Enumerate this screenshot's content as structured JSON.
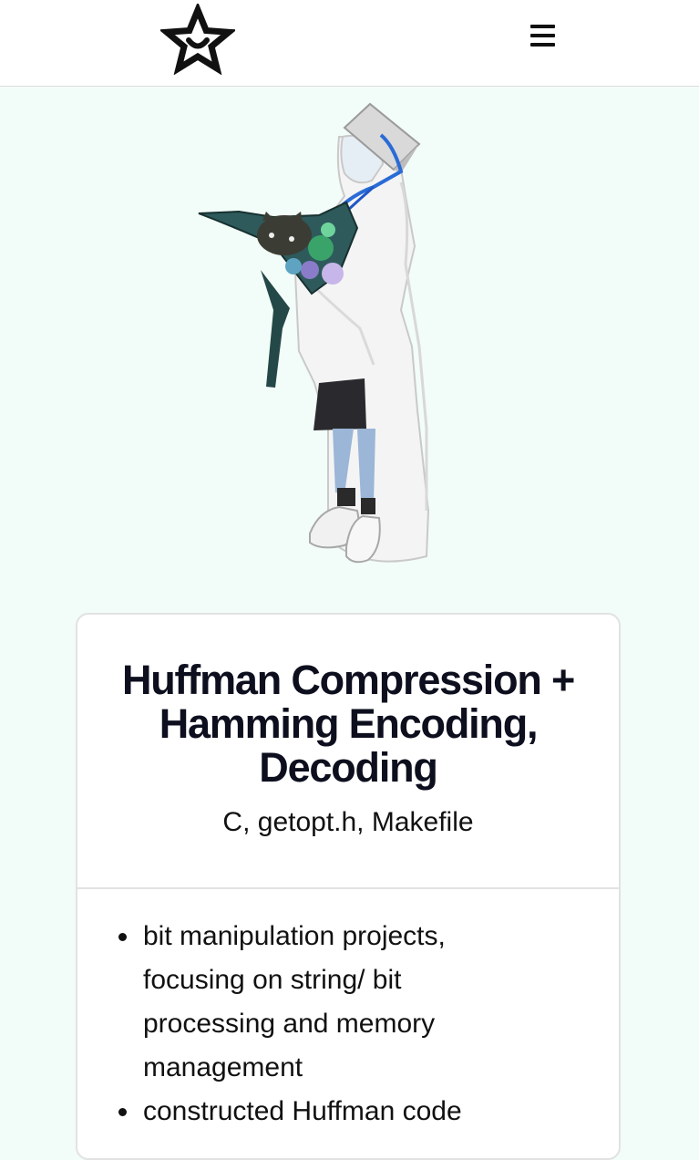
{
  "nav": {
    "logo_icon": "smiling-star-icon",
    "menu_icon": "hamburger-menu-icon"
  },
  "hero": {
    "image": "graduate-figure-illustration"
  },
  "project": {
    "title": "Huffman Compression + Hamming Encoding, Decoding",
    "tech": "C, getopt.h, Makefile",
    "bullets": [
      "bit manipulation projects, focusing on string/ bit processing and memory management",
      "constructed Huffman code"
    ]
  },
  "colors": {
    "page_background": "#f2fcf8",
    "card_background": "#ffffff",
    "title_color": "#0d0f1e"
  }
}
